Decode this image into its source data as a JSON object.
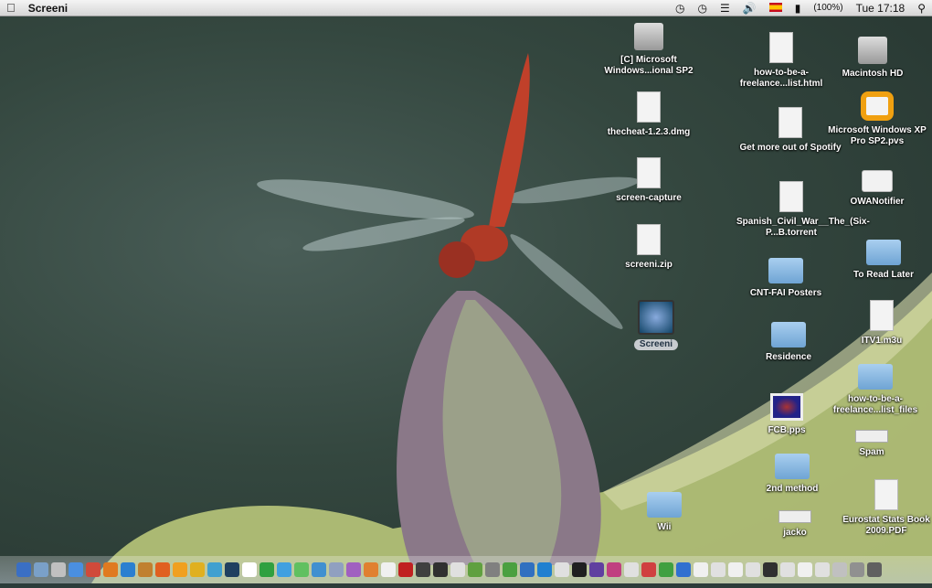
{
  "menubar": {
    "app_name": "Screeni",
    "battery": "(100%)",
    "clock": "Tue 17:18"
  },
  "desktop_items": [
    {
      "label": "[C] Microsoft Windows...ional SP2",
      "kind": "drive"
    },
    {
      "label": "thecheat-1.2.3.dmg",
      "kind": "doc"
    },
    {
      "label": "screen-capture",
      "kind": "doc"
    },
    {
      "label": "screeni.zip",
      "kind": "doc"
    },
    {
      "label": "Screeni",
      "kind": "app"
    },
    {
      "label": "how-to-be-a-freelance...list.html",
      "kind": "doc"
    },
    {
      "label": "Get more out of Spotify",
      "kind": "doc"
    },
    {
      "label": "Spanish_Civil_War__The_(Six-P...B.torrent",
      "kind": "doc"
    },
    {
      "label": "CNT-FAI Posters",
      "kind": "folder"
    },
    {
      "label": "Residence",
      "kind": "folder"
    },
    {
      "label": "FCB.pps",
      "kind": "pps"
    },
    {
      "label": "2nd method",
      "kind": "folder"
    },
    {
      "label": "jacko",
      "kind": "bar"
    },
    {
      "label": "Wii",
      "kind": "folder"
    },
    {
      "label": "Macintosh HD",
      "kind": "drive"
    },
    {
      "label": "Microsoft Windows XP Pro SP2.pvs",
      "kind": "pvs"
    },
    {
      "label": "OWANotifier",
      "kind": "mail"
    },
    {
      "label": "To Read Later",
      "kind": "folder"
    },
    {
      "label": "ITV1.m3u",
      "kind": "doc"
    },
    {
      "label": "how-to-be-a-freelance...list_files",
      "kind": "folder"
    },
    {
      "label": "Spam",
      "kind": "bar"
    },
    {
      "label": "Eurostat Stats Book 2009.PDF",
      "kind": "doc"
    }
  ],
  "dock_colors": [
    "#3a6fc4",
    "#7aa0c8",
    "#c0c0c0",
    "#4a8fe0",
    "#d04a3a",
    "#e07a20",
    "#2a7fd0",
    "#c08030",
    "#e06020",
    "#f0a020",
    "#e0b020",
    "#40a0d0",
    "#204060",
    "#ffffff",
    "#30a040",
    "#40a0e0",
    "#60c060",
    "#4090d0",
    "#90a0c0",
    "#a060c0",
    "#e08030",
    "#f0f0f0",
    "#c02020",
    "#404040",
    "#303030",
    "#e0e0e0",
    "#60a040",
    "#808080",
    "#4aa040",
    "#3070c0",
    "#2080d0",
    "#e0e0e0",
    "#202020",
    "#6040a0",
    "#c04080",
    "#e0e0e0",
    "#d04040",
    "#40a040",
    "#3070d0",
    "#f0f0f0",
    "#e0e0e0",
    "#f0f0f0",
    "#e0e0e0",
    "#303030",
    "#e0e0e0",
    "#f0f0f0",
    "#e0e0e0",
    "#c0c0c0",
    "#909090",
    "#606060"
  ]
}
